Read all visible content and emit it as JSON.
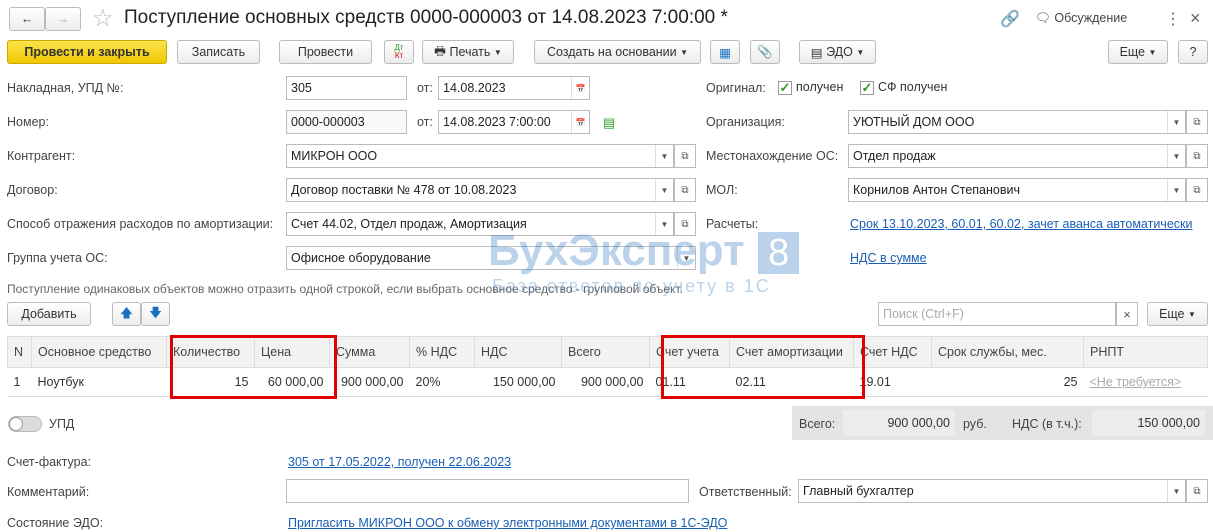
{
  "title": "Поступление основных средств 0000-000003 от 14.08.2023 7:00:00 *",
  "header": {
    "discussion": "Обсуждение"
  },
  "toolbar": {
    "post_close": "Провести и закрыть",
    "save": "Записать",
    "post": "Провести",
    "dtkt_top": "Дт",
    "dtkt_bottom": "Кт",
    "print": "Печать",
    "create_based": "Создать на основании",
    "edo": "ЭДО",
    "more": "Еще",
    "help": "?"
  },
  "form": {
    "invoice_label": "Накладная, УПД №:",
    "invoice_no": "305",
    "from_label": "от:",
    "invoice_date": "14.08.2023",
    "number_label": "Номер:",
    "number": "0000-000003",
    "number_date": "14.08.2023  7:00:00",
    "counterparty_label": "Контрагент:",
    "counterparty": "МИКРОН ООО",
    "contract_label": "Договор:",
    "contract": "Договор поставки № 478 от 10.08.2023",
    "amort_label": "Способ отражения расходов по амортизации:",
    "amort": "Счет 44.02, Отдел продаж, Амортизация",
    "group_label": "Группа учета ОС:",
    "group": "Офисное оборудование",
    "original_label": "Оригинал:",
    "received": "получен",
    "sf_received": "СФ получен",
    "org_label": "Организация:",
    "org": "УЮТНЫЙ ДОМ ООО",
    "location_label": "Местонахождение ОС:",
    "location": "Отдел продаж",
    "mol_label": "МОЛ:",
    "mol": "Корнилов Антон Степанович",
    "settlements_label": "Расчеты:",
    "settlements": "Срок 13.10.2023, 60.01, 60.02, зачет аванса автоматически",
    "vat_link": "НДС в сумме",
    "hint": "Поступление одинаковых объектов можно отразить одной строкой, если выбрать основное средство - групповой объект."
  },
  "watermark": {
    "text": "БухЭксперт",
    "digit": "8",
    "sub": "База ответов по учету в 1С"
  },
  "table_toolbar": {
    "add": "Добавить",
    "search_placeholder": "Поиск (Ctrl+F)",
    "more": "Еще"
  },
  "table": {
    "columns": [
      "N",
      "Основное средство",
      "Количество",
      "Цена",
      "Сумма",
      "% НДС",
      "НДС",
      "Всего",
      "Счет учета",
      "Счет амортизации",
      "Счет НДС",
      "Срок службы, мес.",
      "РНПТ"
    ],
    "rows": [
      [
        "1",
        "Ноутбук",
        "15",
        "60 000,00",
        "900 000,00",
        "20%",
        "150 000,00",
        "900 000,00",
        "01.11",
        "02.11",
        "19.01",
        "25",
        "<Не требуется>"
      ]
    ]
  },
  "footer": {
    "upd": "УПД",
    "total_label": "Всего:",
    "total": "900 000,00",
    "currency": "руб.",
    "vat_label": "НДС (в т.ч.):",
    "vat": "150 000,00",
    "sf_label": "Счет-фактура:",
    "sf_link": "305 от 17.05.2022, получен 22.06.2023",
    "comment_label": "Комментарий:",
    "comment": "",
    "responsible_label": "Ответственный:",
    "responsible": "Главный бухгалтер",
    "edo_label": "Состояние ЭДО:",
    "edo_link": "Пригласить МИКРОН ООО к обмену электронными документами в 1С-ЭДО"
  }
}
